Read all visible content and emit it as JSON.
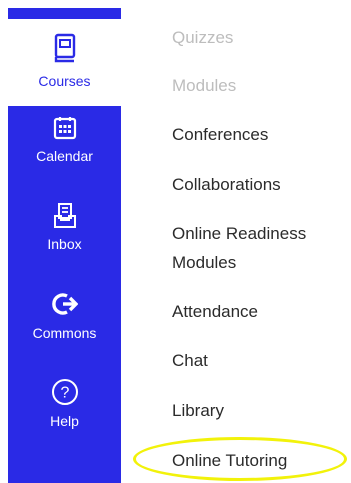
{
  "global_nav": {
    "items": [
      {
        "label": "Courses",
        "icon": "book-icon",
        "active": true
      },
      {
        "label": "Calendar",
        "icon": "calendar-icon",
        "active": false
      },
      {
        "label": "Inbox",
        "icon": "inbox-icon",
        "active": false
      },
      {
        "label": "Commons",
        "icon": "commons-arrow-icon",
        "active": false
      },
      {
        "label": "Help",
        "icon": "question-circle-icon",
        "active": false
      }
    ]
  },
  "course_menu": {
    "items": [
      {
        "label": "Quizzes",
        "state": "disabled"
      },
      {
        "label": "Modules",
        "state": "disabled"
      },
      {
        "label": "Conferences",
        "state": "enabled"
      },
      {
        "label": "Collaborations",
        "state": "enabled"
      },
      {
        "label_line1": "Online Readiness",
        "label_line2": "Modules",
        "state": "enabled"
      },
      {
        "label": "Attendance",
        "state": "enabled"
      },
      {
        "label": "Chat",
        "state": "enabled"
      },
      {
        "label": "Library",
        "state": "enabled"
      },
      {
        "label": "Online Tutoring",
        "state": "enabled",
        "highlighted": true
      }
    ]
  },
  "colors": {
    "nav_background": "#2a2ae6",
    "active_item_background": "#ffffff",
    "highlight_ring": "#f2f20a",
    "disabled_text": "#bdbdbd",
    "text": "#2b2b2b"
  }
}
